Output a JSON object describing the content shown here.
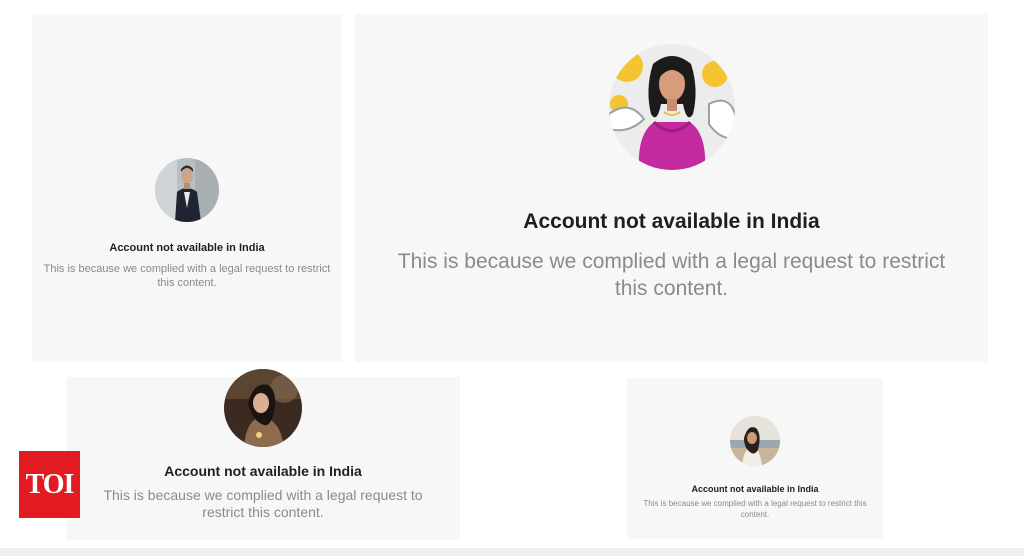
{
  "cards": [
    {
      "title": "Account not available in India",
      "description": "This is because we complied with a legal request to restrict this content.",
      "avatar_icon": "man-in-suit-avatar"
    },
    {
      "title": "Account not available in India",
      "description": "This is because we complied with a legal request to restrict this content.",
      "avatar_icon": "woman-in-pink-illustration-avatar"
    },
    {
      "title": "Account not available in India",
      "description": "This is because we complied with a legal request to restrict this content.",
      "avatar_icon": "woman-portrait-avatar"
    },
    {
      "title": "Account not available in India",
      "description": "This is because we complied with a legal request to restrict this content.",
      "avatar_icon": "woman-on-beach-avatar"
    }
  ],
  "logo": {
    "text": "TOI",
    "color": "#e21b22"
  },
  "colors": {
    "card_background": "#f7f7f8",
    "title": "#1f1f1f",
    "description": "#8a8a8a"
  }
}
